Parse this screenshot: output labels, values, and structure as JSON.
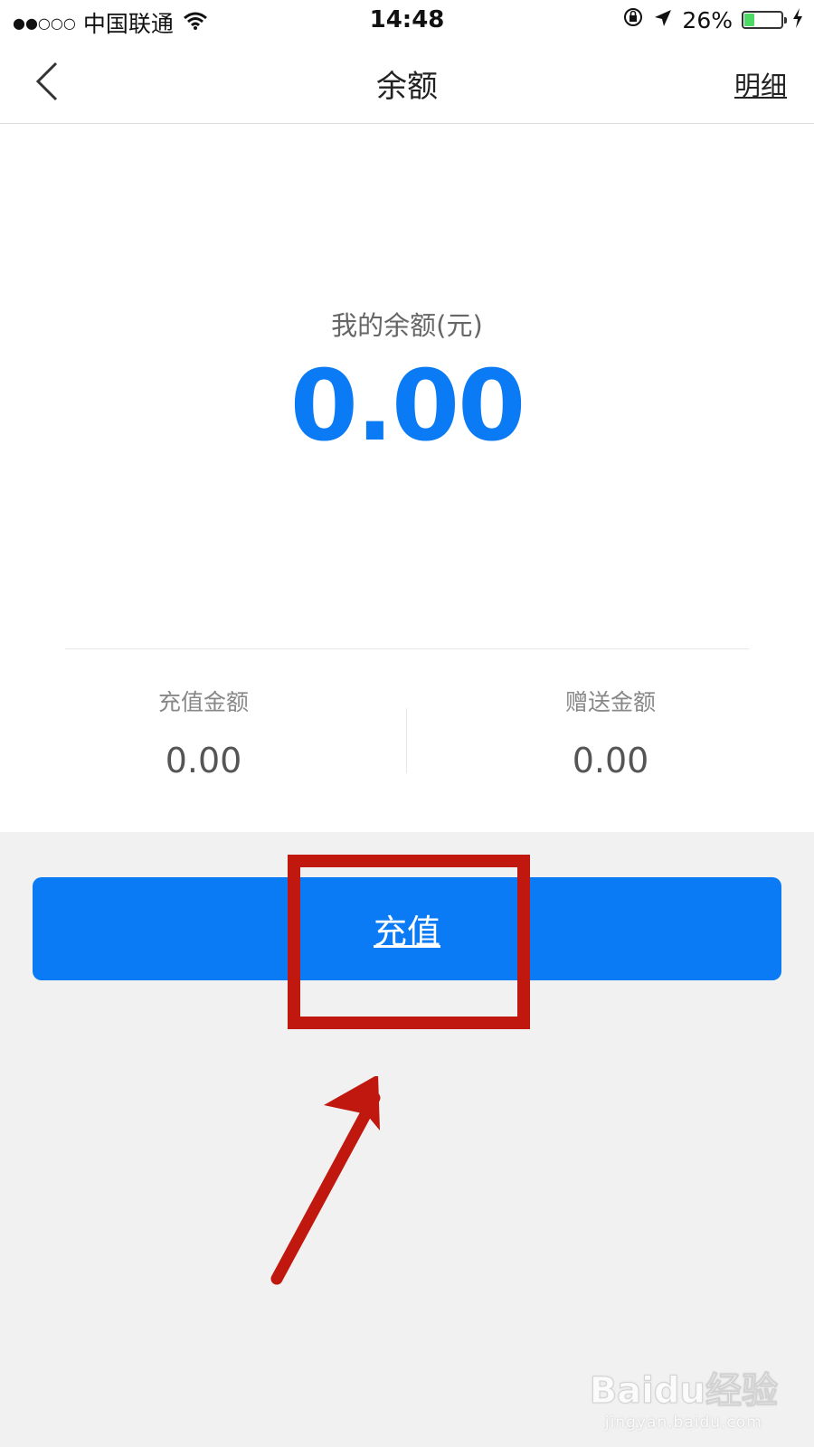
{
  "status_bar": {
    "signal": "●●○○○",
    "carrier": "中国联通",
    "time": "14:48",
    "battery": "26%",
    "battery_level": 0.26,
    "icons": [
      "wifi-icon",
      "rotation-lock-icon",
      "location-arrow-icon",
      "battery-icon",
      "charging-bolt-icon"
    ]
  },
  "nav": {
    "title": "余额",
    "detail_link": "明细",
    "back_icon": "chevron-left-icon"
  },
  "balance": {
    "label": "我的余额(元)",
    "value": "0.00"
  },
  "stats": [
    {
      "label": "充值金额",
      "value": "0.00"
    },
    {
      "label": "赠送金额",
      "value": "0.00"
    }
  ],
  "actions": {
    "recharge_label": "充值"
  },
  "annotation": {
    "box_color": "#c0180f",
    "arrow_icon": "red-arrow-icon"
  },
  "watermark": {
    "logo": "Baidu经验",
    "url": "jingyan.baidu.com"
  },
  "colors": {
    "accent": "#0a7bf4",
    "background": "#f1f1f1",
    "annotation": "#c0180f"
  }
}
